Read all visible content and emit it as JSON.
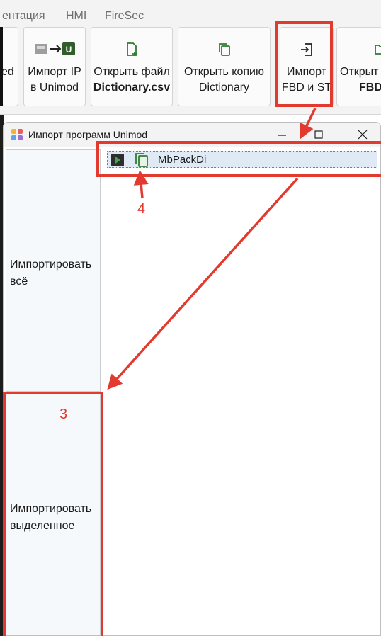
{
  "ribbon": {
    "tabs": [
      "ентация",
      "HMI",
      "FireSec"
    ],
    "buttons": [
      {
        "line1": "ed",
        "line2": ""
      },
      {
        "line1": "Импорт IP",
        "line2": "в Unimod",
        "icon": "ip-to-unimod-icon"
      },
      {
        "line1": "Открыть файл",
        "line2": "Dictionary.csv",
        "icon": "file-add-icon"
      },
      {
        "line1": "Открыть копию",
        "line2": "Dictionary",
        "icon": "copy-icon"
      },
      {
        "line1": "Импорт",
        "line2": "FBD и ST",
        "icon": "import-icon"
      },
      {
        "line1": "Открыт",
        "line2": "FBD",
        "icon": "folder-icon"
      }
    ],
    "icon_u_letter": "U"
  },
  "dialog": {
    "title": "Импорт программ Unimod",
    "import_all_label": "Импортировать всё",
    "import_selected_label": "Импортировать выделенное",
    "tree": [
      {
        "label": "MbPackDi",
        "selected": true
      }
    ]
  },
  "annotations": {
    "label_3": "3",
    "label_4": "4",
    "color": "#e23a2f"
  },
  "colors": {
    "icon_green": "#2e7d32",
    "dark_green": "#2f5e2a",
    "selection": "#dfeaf5",
    "annotation": "#e23a2f"
  }
}
